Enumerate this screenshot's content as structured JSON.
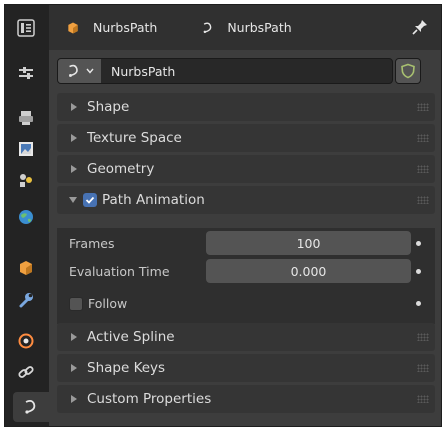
{
  "header": {
    "object_name": "NurbsPath",
    "data_name": "NurbsPath"
  },
  "datablock": {
    "name": "NurbsPath"
  },
  "sidebar": {
    "tabs": [
      {
        "name": "tool"
      },
      {
        "name": "render"
      },
      {
        "name": "output"
      },
      {
        "name": "view-layer"
      },
      {
        "name": "scene"
      },
      {
        "name": "world"
      },
      {
        "name": "object"
      },
      {
        "name": "modifiers"
      },
      {
        "name": "physics"
      },
      {
        "name": "constraints"
      },
      {
        "name": "data",
        "active": true
      }
    ]
  },
  "panels": {
    "shape": "Shape",
    "texture_space": "Texture Space",
    "geometry": "Geometry",
    "path_animation": "Path Animation",
    "active_spline": "Active Spline",
    "shape_keys": "Shape Keys",
    "custom_properties": "Custom Properties"
  },
  "path_animation": {
    "enabled": true,
    "frames_label": "Frames",
    "frames_value": "100",
    "eval_time_label": "Evaluation Time",
    "eval_time_value": "0.000",
    "follow_label": "Follow",
    "follow_checked": false
  },
  "colors": {
    "accent": "#4772b3",
    "object_orange": "#f0a040",
    "shield_green": "#a8c070"
  }
}
